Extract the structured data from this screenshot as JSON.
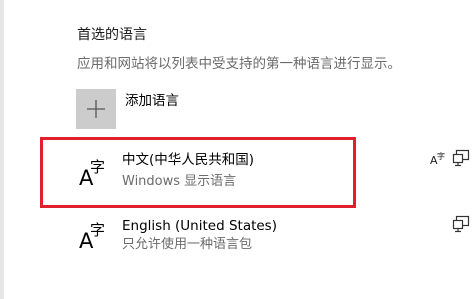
{
  "preferred_languages": {
    "title": "首选的语言",
    "description": "应用和网站将以列表中受支持的第一种语言进行显示。"
  },
  "add_language": {
    "label": "添加语言",
    "icon": "plus-icon"
  },
  "languages": [
    {
      "name": "中文(中华人民共和国)",
      "subtitle": "Windows 显示语言",
      "icon": "language-char-icon",
      "features": [
        "speech-recognition-icon",
        "display-language-icon"
      ],
      "selected": true
    },
    {
      "name": "English (United States)",
      "subtitle": "只允许使用一种语言包",
      "icon": "language-char-icon",
      "features": [
        "display-language-icon"
      ],
      "selected": false
    }
  ],
  "colors": {
    "highlight_border": "#e0202b",
    "add_button_bg": "#cccccc",
    "secondary_text": "#6b6b6b"
  }
}
